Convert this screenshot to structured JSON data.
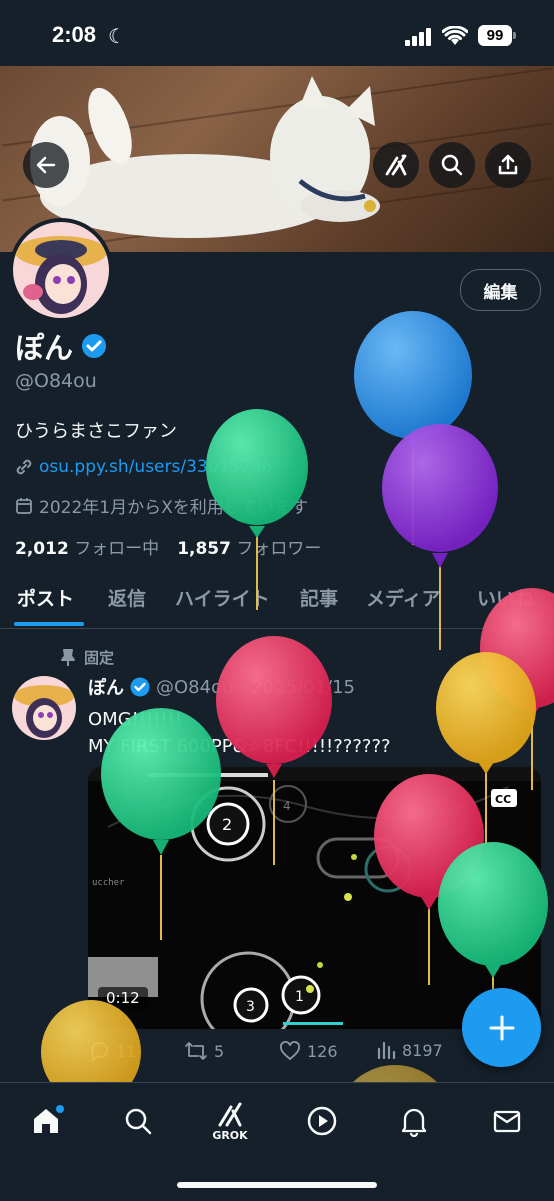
{
  "status_bar": {
    "time": "2:08",
    "battery": "99"
  },
  "header": {
    "back_icon": "arrow-left-icon",
    "grok_icon": "grok-icon",
    "search_icon": "search-icon",
    "share_icon": "share-icon"
  },
  "profile": {
    "edit_label": "編集",
    "display_name": "ぽん",
    "handle": "@O84ou",
    "bio": "ひうらまさこファン",
    "link": "osu.ppy.sh/users/33015746",
    "joined": "2022年1月からXを利用しています",
    "following_count": "2,012",
    "following_label": "フォロー中",
    "followers_count": "1,857",
    "followers_label": "フォロワー"
  },
  "tabs": [
    "ポスト",
    "返信",
    "ハイライト",
    "記事",
    "メディア",
    "いいね"
  ],
  "active_tab": "ポスト",
  "post": {
    "pinned_label": "固定",
    "name": "ぽん",
    "handle": "@O84ou",
    "date": "2025/01/15",
    "text_line1": "OMG!!!!!!!",
    "text_line2": "MY FIRST 600PP&☆8FC!!!!!??????",
    "video_time": "0:12",
    "replies": "11",
    "reposts": "5",
    "likes": "126",
    "views": "8197"
  },
  "nav": {
    "grok_label": "GROK"
  },
  "colors": {
    "background": "#15202b",
    "accent": "#1d9bf0",
    "muted": "#8b98a5",
    "verified": "#1d9bf0"
  }
}
